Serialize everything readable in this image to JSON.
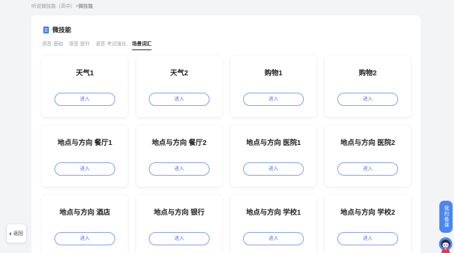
{
  "breadcrumb": {
    "parent": "听说微技能（高中）",
    "separator": ">",
    "current": "微技能"
  },
  "header": {
    "icon": "document-icon",
    "title": "微技能"
  },
  "tabs": [
    {
      "label": "语音·基础",
      "active": false
    },
    {
      "label": "语音·提升",
      "active": false
    },
    {
      "label": "语音·考试强化",
      "active": false
    },
    {
      "label": "场景词汇",
      "active": true
    }
  ],
  "cards": [
    {
      "title": "天气1",
      "button_label": "进入"
    },
    {
      "title": "天气2",
      "button_label": "进入"
    },
    {
      "title": "购物1",
      "button_label": "进入"
    },
    {
      "title": "购物2",
      "button_label": "进入"
    },
    {
      "title": "地点与方向 餐厅1",
      "button_label": "进入"
    },
    {
      "title": "地点与方向 餐厅2",
      "button_label": "进入"
    },
    {
      "title": "地点与方向 医院1",
      "button_label": "进入"
    },
    {
      "title": "地点与方向 医院2",
      "button_label": "进入"
    },
    {
      "title": "地点与方向 酒店",
      "button_label": "进入"
    },
    {
      "title": "地点与方向 银行",
      "button_label": "进入"
    },
    {
      "title": "地点与方向 学校1",
      "button_label": "进入"
    },
    {
      "title": "地点与方向 学校2",
      "button_label": "进入"
    }
  ],
  "back_button": {
    "icon": "chevron-left-icon",
    "label": "返回"
  },
  "side_tab": {
    "label": "我的备课"
  },
  "assistant": {
    "icon": "assistant-avatar-icon"
  },
  "colors": {
    "accent": "#4a86f5",
    "page_background": "#f3f4f6",
    "button_border": "#7d9cf2",
    "button_text": "#4d70e0"
  }
}
